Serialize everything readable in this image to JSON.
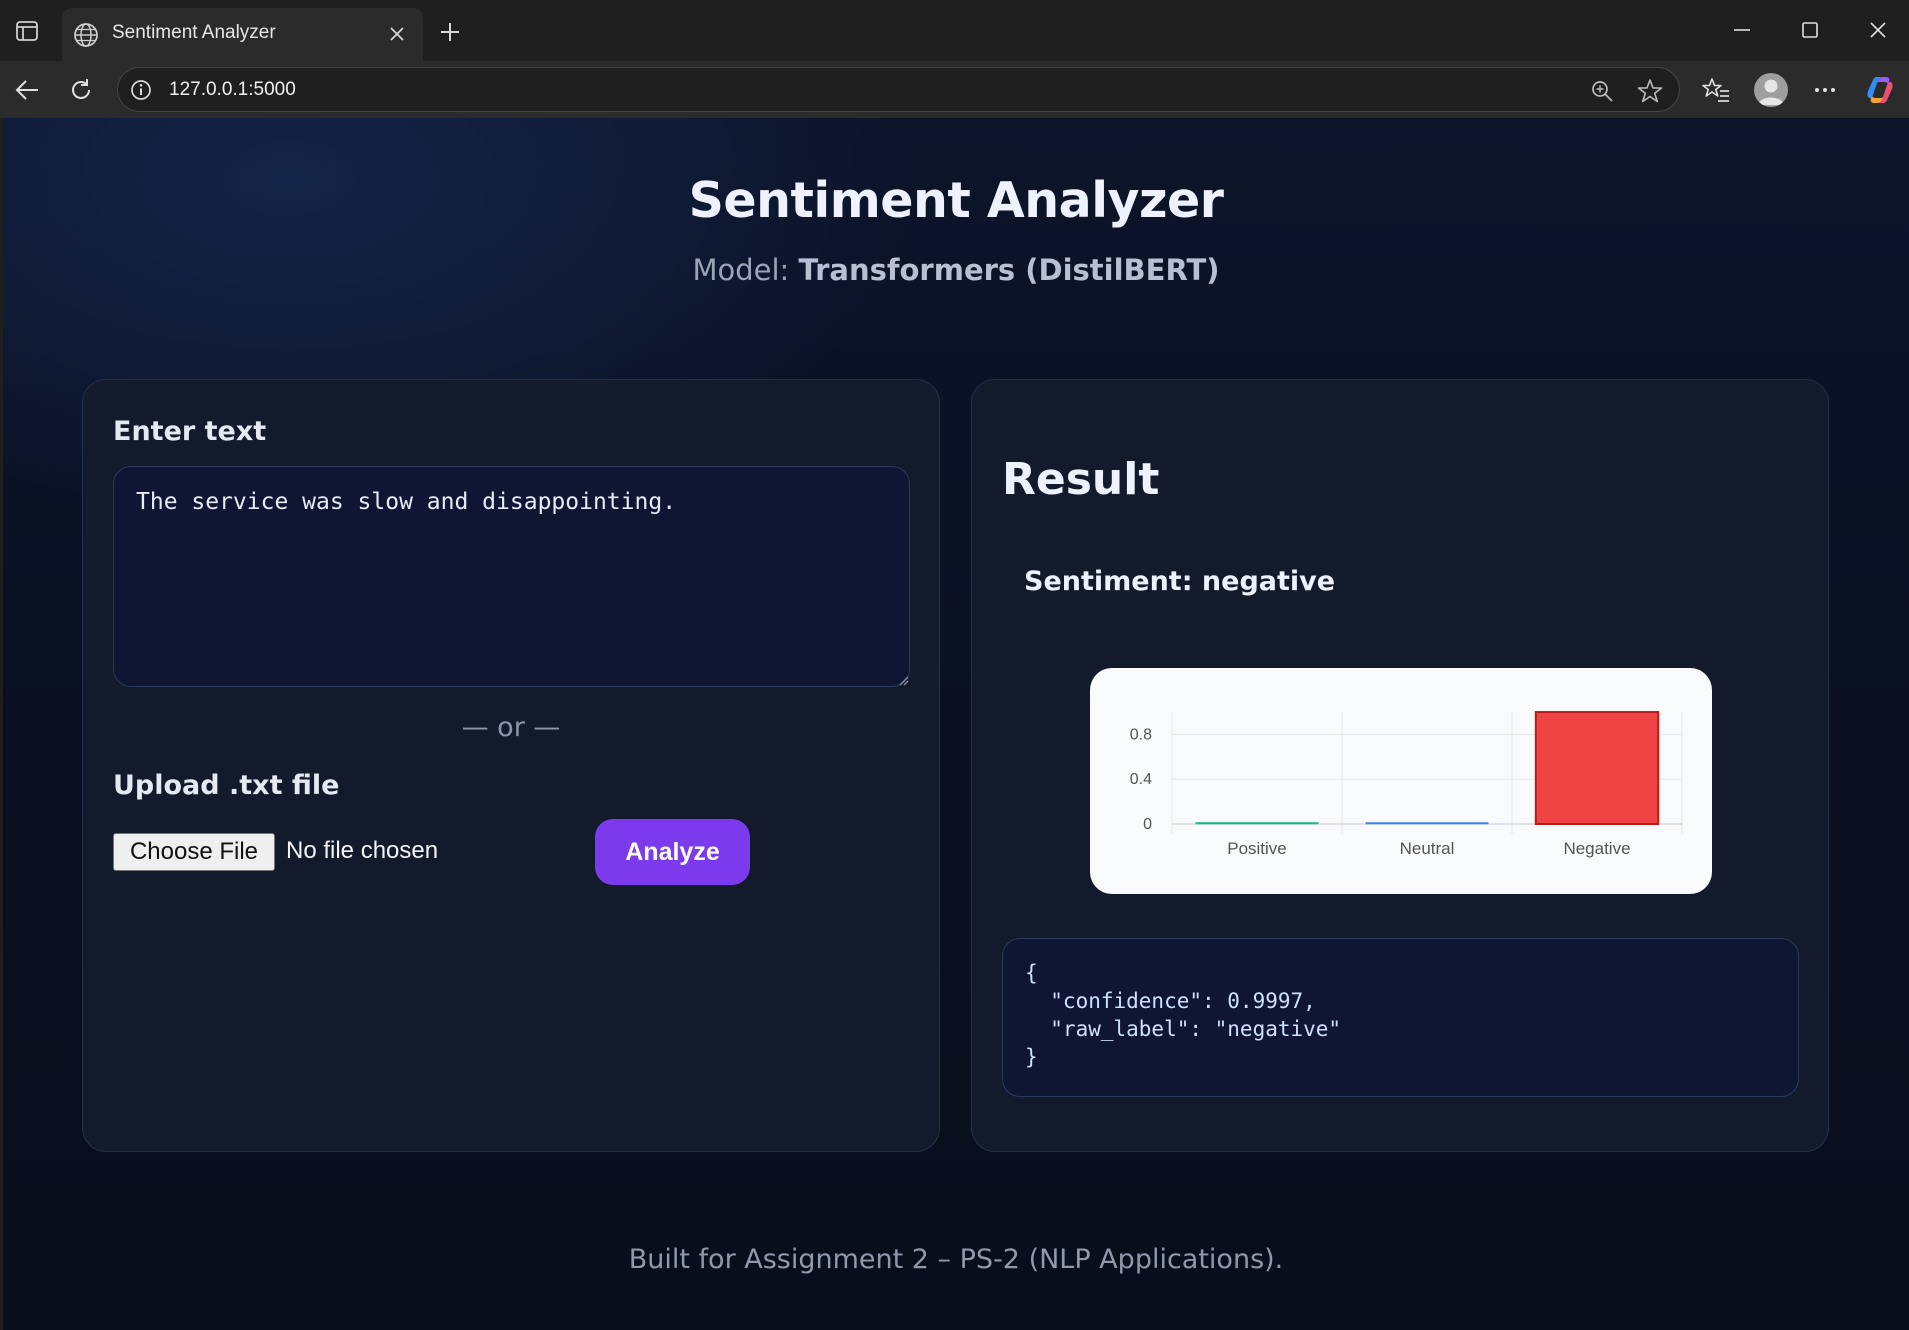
{
  "browser": {
    "tab_title": "Sentiment Analyzer",
    "url": "127.0.0.1:5000"
  },
  "header": {
    "title": "Sentiment Analyzer",
    "model_prefix": "Model: ",
    "model_name": "Transformers (DistilBERT)"
  },
  "input_card": {
    "enter_text_label": "Enter text",
    "text_value": "The service was slow and disappointing.",
    "separator": "— or —",
    "upload_label": "Upload .txt file",
    "choose_file_label": "Choose File",
    "file_status": "No file chosen",
    "analyze_label": "Analyze"
  },
  "result_card": {
    "title": "Result",
    "sentiment_text": "Sentiment: negative",
    "json_lines": [
      "{",
      "  \"confidence\": 0.9997,",
      "  \"raw_label\": \"negative\"",
      "}"
    ]
  },
  "chart_data": {
    "type": "bar",
    "categories": [
      "Positive",
      "Neutral",
      "Negative"
    ],
    "values": [
      0.0002,
      0.0001,
      0.9997
    ],
    "yticks": [
      "0",
      "0.4",
      "0.8"
    ],
    "ylim": [
      0,
      1
    ],
    "colors": [
      "#10b981",
      "#3b82f6",
      "#ef4444"
    ],
    "grid": true
  },
  "footer": {
    "text": "Built for Assignment 2 – PS-2 (NLP Applications)."
  }
}
